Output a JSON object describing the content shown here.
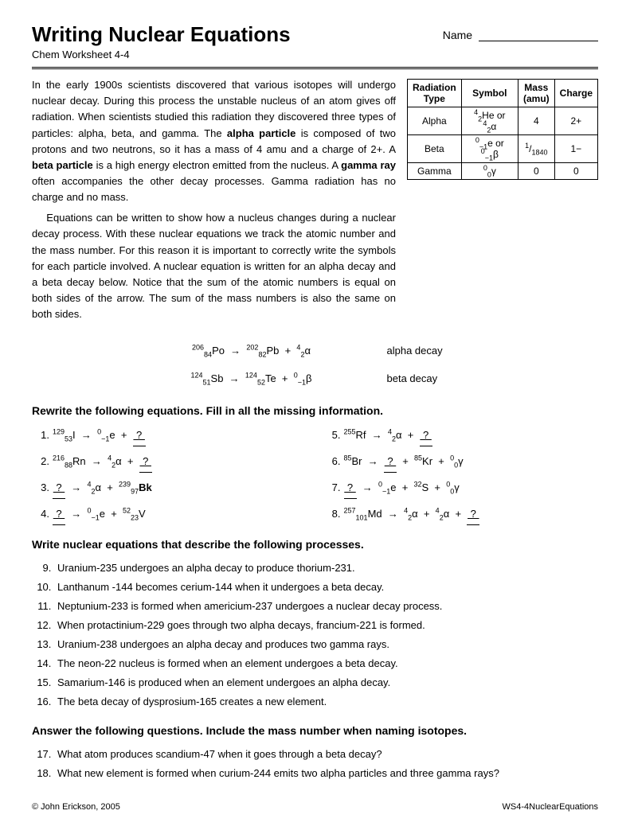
{
  "header": {
    "title": "Writing Nuclear Equations",
    "subtitle": "Chem Worksheet 4-4",
    "name_label": "Name"
  },
  "intro": {
    "paragraph1": "In the early 1900s scientists discovered that various isotopes will undergo nuclear decay. During this process the unstable nucleus of an atom gives off radiation. When scientists studied this radiation they discovered three types of particles: alpha, beta, and gamma. The ",
    "bold1": "alpha particle",
    "p1_cont": " is composed of two protons and two neutrons, so it has a mass of 4 amu and a charge of 2+. A ",
    "bold2": "beta particle",
    "p1_cont2": " is a high energy electron emitted from the nucleus. A ",
    "bold3": "gamma ray",
    "p1_cont3": " often accompanies the other decay processes. Gamma radiation has no charge and no mass.",
    "paragraph2": "Equations can be written to show how a nucleus changes during a nuclear decay process. With these nuclear equations we track the atomic number and the mass number. For this reason it is important to correctly write the symbols for each particle involved. A nuclear equation is written for an alpha decay and a beta decay below. Notice that the sum of the atomic numbers is equal on both sides of the arrow. The sum of the mass numbers is also the same on both sides."
  },
  "radiation_table": {
    "headers": [
      "Radiation Type",
      "Symbol",
      "Mass (amu)",
      "Charge"
    ],
    "rows": [
      [
        "Alpha",
        "⁴₂He or ⁴₂α",
        "4",
        "2+"
      ],
      [
        "Beta",
        "⁰₋₁e or ⁰₋₁β",
        "1/1840",
        "1−"
      ],
      [
        "Gamma",
        "⁰₀γ",
        "0",
        "0"
      ]
    ]
  },
  "examples": {
    "alpha": {
      "formula": "²⁰⁶₈₄Po → ²⁰²₈₂Pb + ⁴₂α",
      "label": "alpha decay"
    },
    "beta": {
      "formula": "¹²⁴₅₁Sb → ¹²⁴₅₂Te + ⁰₋₁β",
      "label": "beta decay"
    }
  },
  "section1": {
    "heading": "Rewrite the following equations. Fill in all the missing information.",
    "problems": [
      {
        "num": "1.",
        "text": "¹²⁹₅₃I → ⁰₋₁e + ?"
      },
      {
        "num": "2.",
        "text": "²¹⁶₈₈Rn → ⁴₂α + ?"
      },
      {
        "num": "3.",
        "text": "? → ⁴₂α + ²³⁹₉₇Bk"
      },
      {
        "num": "4.",
        "text": "? → ⁰₋₁e + ⁵²₂₃V"
      },
      {
        "num": "5.",
        "text": "²⁵⁵Rf → ⁴₂α + ?"
      },
      {
        "num": "6.",
        "text": "⁸⁵Br → ? + ⁸⁵Kr + ⁰₀γ"
      },
      {
        "num": "7.",
        "text": "? → ⁰₋₁e + ³²S + ⁰₀γ"
      },
      {
        "num": "8.",
        "text": "²⁵⁷₁₀₁Md → ⁴₂α + ⁴₂α + ?"
      }
    ]
  },
  "section2": {
    "heading": "Write nuclear equations that describe the following processes.",
    "problems": [
      {
        "num": "9.",
        "text": "Uranium-235 undergoes an alpha decay to produce thorium-231."
      },
      {
        "num": "10.",
        "text": "Lanthanum -144 becomes cerium-144 when it undergoes a beta decay."
      },
      {
        "num": "11.",
        "text": "Neptunium-233 is formed when americium-237 undergoes a nuclear decay process."
      },
      {
        "num": "12.",
        "text": "When protactinium-229 goes through two alpha decays, francium-221 is formed."
      },
      {
        "num": "13.",
        "text": "Uranium-238 undergoes an alpha decay and produces two gamma rays."
      },
      {
        "num": "14.",
        "text": "The neon-22 nucleus is formed when an element undergoes a beta decay."
      },
      {
        "num": "15.",
        "text": "Samarium-146 is produced when an element undergoes an alpha decay."
      },
      {
        "num": "16.",
        "text": "The beta decay of dysprosium-165 creates a new element."
      }
    ]
  },
  "section3": {
    "heading": "Answer the following questions. Include the mass number when naming isotopes.",
    "problems": [
      {
        "num": "17.",
        "text": "What atom produces scandium-47 when it goes through a beta decay?"
      },
      {
        "num": "18.",
        "text": "What new element is formed when curium-244 emits two alpha particles and three gamma rays?"
      }
    ]
  },
  "footer": {
    "copyright": "© John Erickson, 2005",
    "worksheet_id": "WS4-4NuclearEquations"
  }
}
